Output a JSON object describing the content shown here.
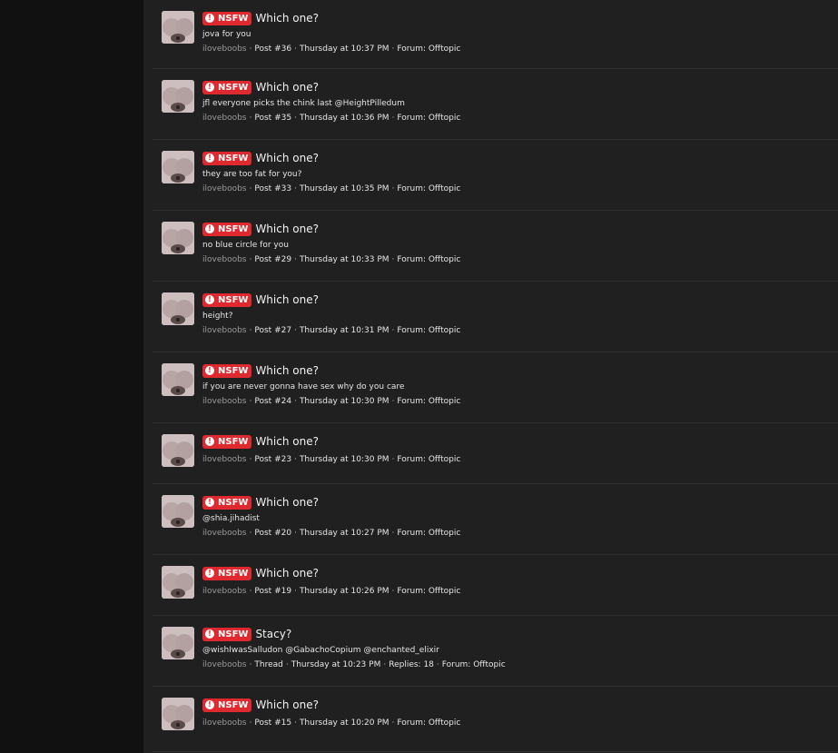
{
  "results": [
    {
      "badge": "NSFW",
      "title": "Which one?",
      "snippet": "jova for you",
      "author": "iloveboobs",
      "post": "Post #36",
      "time": "Thursday at 10:37 PM",
      "forum": "Forum: Offtopic"
    },
    {
      "badge": "NSFW",
      "title": "Which one?",
      "snippet": "jfl everyone picks the chink last @HeightPilledum",
      "author": "iloveboobs",
      "post": "Post #35",
      "time": "Thursday at 10:36 PM",
      "forum": "Forum: Offtopic"
    },
    {
      "badge": "NSFW",
      "title": "Which one?",
      "snippet": "they are too fat for you?",
      "author": "iloveboobs",
      "post": "Post #33",
      "time": "Thursday at 10:35 PM",
      "forum": "Forum: Offtopic"
    },
    {
      "badge": "NSFW",
      "title": "Which one?",
      "snippet": "no blue circle for you",
      "author": "iloveboobs",
      "post": "Post #29",
      "time": "Thursday at 10:33 PM",
      "forum": "Forum: Offtopic"
    },
    {
      "badge": "NSFW",
      "title": "Which one?",
      "snippet": "height?",
      "author": "iloveboobs",
      "post": "Post #27",
      "time": "Thursday at 10:31 PM",
      "forum": "Forum: Offtopic"
    },
    {
      "badge": "NSFW",
      "title": "Which one?",
      "snippet": "if you are never gonna have sex why do you care",
      "author": "iloveboobs",
      "post": "Post #24",
      "time": "Thursday at 10:30 PM",
      "forum": "Forum: Offtopic"
    },
    {
      "badge": "NSFW",
      "title": "Which one?",
      "snippet": "",
      "author": "iloveboobs",
      "post": "Post #23",
      "time": "Thursday at 10:30 PM",
      "forum": "Forum: Offtopic"
    },
    {
      "badge": "NSFW",
      "title": "Which one?",
      "snippet": "@shia.jihadist",
      "author": "iloveboobs",
      "post": "Post #20",
      "time": "Thursday at 10:27 PM",
      "forum": "Forum: Offtopic"
    },
    {
      "badge": "NSFW",
      "title": "Which one?",
      "snippet": "",
      "author": "iloveboobs",
      "post": "Post #19",
      "time": "Thursday at 10:26 PM",
      "forum": "Forum: Offtopic"
    },
    {
      "badge": "NSFW",
      "title": "Stacy?",
      "snippet": "@wishIwasSalludon @GabachoCopium @enchanted_elixir",
      "author": "iloveboobs",
      "post": "Thread",
      "time": "Thursday at 10:23 PM",
      "replies": "Replies: 18",
      "forum": "Forum: Offtopic"
    },
    {
      "badge": "NSFW",
      "title": "Which one?",
      "snippet": "",
      "author": "iloveboobs",
      "post": "Post #15",
      "time": "Thursday at 10:20 PM",
      "forum": "Forum: Offtopic"
    }
  ],
  "icons": {
    "badge": "alert-icon",
    "avatar": "user-avatar"
  },
  "colors": {
    "badge_bg": "#e0282f",
    "panel_bg": "#202020",
    "page_bg": "#111111",
    "author": "#9a9a9a"
  }
}
